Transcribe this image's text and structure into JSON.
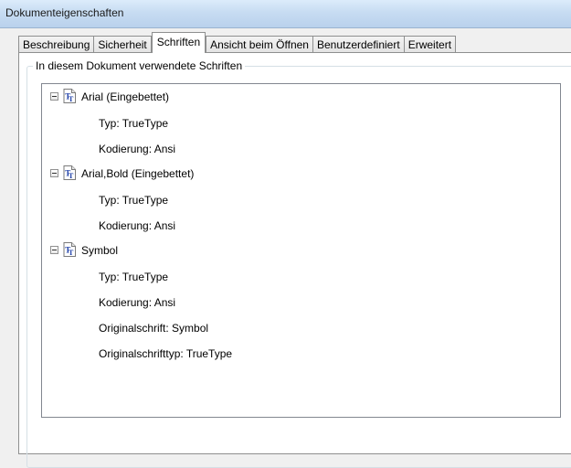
{
  "window": {
    "title": "Dokumenteigenschaften"
  },
  "tabs": [
    {
      "label": "Beschreibung",
      "active": false
    },
    {
      "label": "Sicherheit",
      "active": false
    },
    {
      "label": "Schriften",
      "active": true
    },
    {
      "label": "Ansicht beim Öffnen",
      "active": false
    },
    {
      "label": "Benutzerdefiniert",
      "active": false
    },
    {
      "label": "Erweitert",
      "active": false
    }
  ],
  "group": {
    "label": "In diesem Dokument verwendete Schriften"
  },
  "fonts": [
    {
      "name": "Arial (Eingebettet)",
      "icon": "truetype-font-icon",
      "props": [
        "Typ: TrueType",
        "Kodierung: Ansi"
      ]
    },
    {
      "name": "Arial,Bold (Eingebettet)",
      "icon": "truetype-font-icon",
      "props": [
        "Typ: TrueType",
        "Kodierung: Ansi"
      ]
    },
    {
      "name": "Symbol",
      "icon": "truetype-font-icon",
      "props": [
        "Typ: TrueType",
        "Kodierung: Ansi",
        "Originalschrift: Symbol",
        "Originalschrifttyp: TrueType"
      ]
    }
  ]
}
